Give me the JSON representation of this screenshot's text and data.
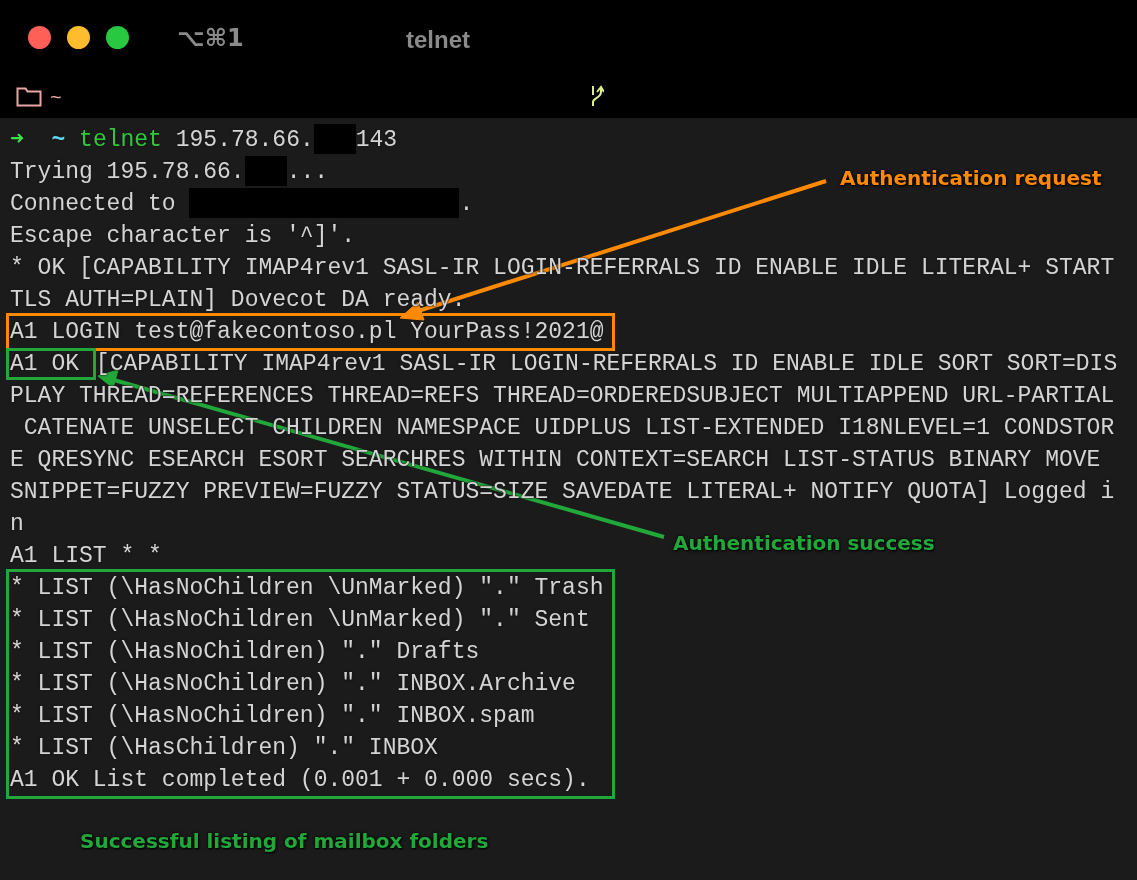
{
  "window": {
    "shortcut": "⌥⌘1",
    "title": "telnet"
  },
  "toolbar": {
    "path": "~"
  },
  "terminal": {
    "items": [
      {
        "segments": [
          {
            "kind": "arrow",
            "text": "➜"
          },
          {
            "kind": "cwd",
            "text": "~"
          },
          {
            "kind": "command",
            "text": "telnet"
          },
          {
            "kind": "plain",
            "text": " 195.78.66."
          },
          {
            "kind": "redacted_short"
          },
          {
            "kind": "plain",
            "text": "143"
          }
        ]
      },
      {
        "segments": [
          {
            "kind": "plain",
            "text": "Trying 195.78.66."
          },
          {
            "kind": "redacted_short"
          },
          {
            "kind": "plain",
            "text": "..."
          }
        ]
      },
      {
        "segments": [
          {
            "kind": "plain",
            "text": "Connected to "
          },
          {
            "kind": "redacted_long"
          },
          {
            "kind": "plain",
            "text": "."
          }
        ]
      },
      {
        "segments": [
          {
            "kind": "plain",
            "text": "Escape character is '^]'."
          }
        ]
      },
      {
        "segments": [
          {
            "kind": "plain",
            "text": "* OK [CAPABILITY IMAP4rev1 SASL-IR LOGIN-REFERRALS ID ENABLE IDLE LITERAL+ START"
          }
        ]
      },
      {
        "segments": [
          {
            "kind": "plain",
            "text": "TLS AUTH=PLAIN] Dovecot DA ready."
          }
        ]
      },
      {
        "kind": "group",
        "color": "#ff8a00",
        "lines": [
          {
            "segments": [
              {
                "kind": "plain",
                "text": "A1 LOGIN test@fakecontoso.pl YourPass!2021@"
              }
            ]
          }
        ]
      },
      {
        "segments": [
          {
            "kind": "boxed",
            "color": "#22a83a",
            "text": "A1 OK "
          },
          {
            "kind": "plain",
            "text": "[CAPABILITY IMAP4rev1 SASL-IR LOGIN-REFERRALS ID ENABLE IDLE SORT SORT=DIS"
          }
        ]
      },
      {
        "segments": [
          {
            "kind": "plain",
            "text": "PLAY THREAD=REFERENCES THREAD=REFS THREAD=ORDEREDSUBJECT MULTIAPPEND URL-PARTIAL"
          }
        ]
      },
      {
        "segments": [
          {
            "kind": "plain",
            "text": " CATENATE UNSELECT CHILDREN NAMESPACE UIDPLUS LIST-EXTENDED I18NLEVEL=1 CONDSTOR"
          }
        ]
      },
      {
        "segments": [
          {
            "kind": "plain",
            "text": "E QRESYNC ESEARCH ESORT SEARCHRES WITHIN CONTEXT=SEARCH LIST-STATUS BINARY MOVE"
          }
        ]
      },
      {
        "segments": [
          {
            "kind": "plain",
            "text": "SNIPPET=FUZZY PREVIEW=FUZZY STATUS=SIZE SAVEDATE LITERAL+ NOTIFY QUOTA] Logged i"
          }
        ]
      },
      {
        "segments": [
          {
            "kind": "plain",
            "text": "n"
          }
        ]
      },
      {
        "segments": [
          {
            "kind": "plain",
            "text": "A1 LIST * *"
          }
        ]
      },
      {
        "kind": "group",
        "color": "#22a83a",
        "lines": [
          {
            "segments": [
              {
                "kind": "plain",
                "text": "* LIST (\\HasNoChildren \\UnMarked) \".\" Trash"
              }
            ]
          },
          {
            "segments": [
              {
                "kind": "plain",
                "text": "* LIST (\\HasNoChildren \\UnMarked) \".\" Sent"
              }
            ]
          },
          {
            "segments": [
              {
                "kind": "plain",
                "text": "* LIST (\\HasNoChildren) \".\" Drafts"
              }
            ]
          },
          {
            "segments": [
              {
                "kind": "plain",
                "text": "* LIST (\\HasNoChildren) \".\" INBOX.Archive"
              }
            ]
          },
          {
            "segments": [
              {
                "kind": "plain",
                "text": "* LIST (\\HasNoChildren) \".\" INBOX.spam"
              }
            ]
          },
          {
            "segments": [
              {
                "kind": "plain",
                "text": "* LIST (\\HasChildren) \".\" INBOX"
              }
            ]
          },
          {
            "segments": [
              {
                "kind": "plain",
                "text": "A1 OK List completed (0.001 + 0.000 secs)."
              }
            ]
          }
        ]
      }
    ]
  },
  "annotations": [
    {
      "kind": "request",
      "text": "Authentication request",
      "color": "#ff8a00"
    },
    {
      "kind": "success",
      "text": "Authentication success",
      "color": "#22a83a"
    },
    {
      "kind": "listing",
      "text": "Successful listing of mailbox folders",
      "color": "#22a83a"
    }
  ]
}
